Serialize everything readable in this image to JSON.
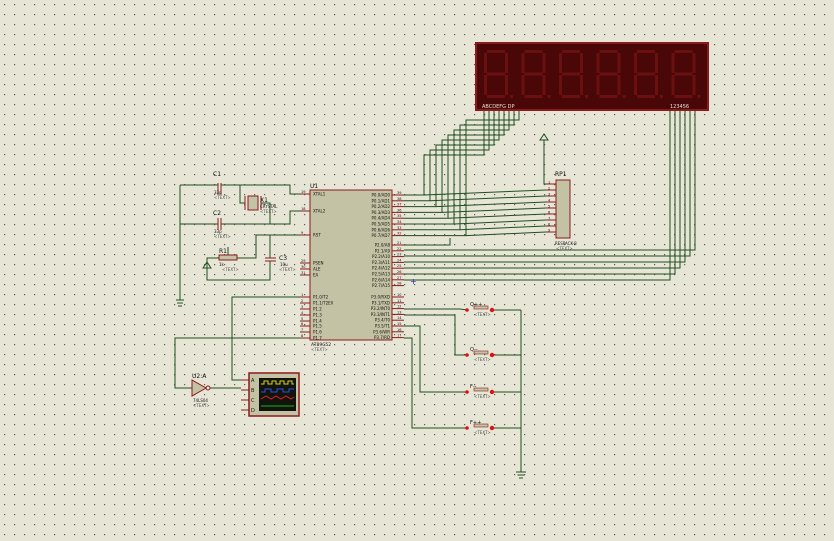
{
  "display": {
    "seg_labels": "ABCDEFG  DP",
    "digit_labels": "123456"
  },
  "u1": {
    "ref": "U1",
    "part": "AT89C52",
    "text_placeholder": "<TEXT>",
    "pins_left": [
      {
        "num": "19",
        "name": "XTAL1"
      },
      {
        "num": "18",
        "name": "XTAL2"
      },
      {
        "num": "9",
        "name": "RST"
      },
      {
        "num": "29",
        "name": "PSEN"
      },
      {
        "num": "30",
        "name": "ALE"
      },
      {
        "num": "31",
        "name": "EA"
      },
      {
        "num": "1",
        "name": "P1.0/T2"
      },
      {
        "num": "2",
        "name": "P1.1/T2EX"
      },
      {
        "num": "3",
        "name": "P1.2"
      },
      {
        "num": "4",
        "name": "P1.3"
      },
      {
        "num": "5",
        "name": "P1.4"
      },
      {
        "num": "6",
        "name": "P1.5"
      },
      {
        "num": "7",
        "name": "P1.6"
      },
      {
        "num": "8",
        "name": "P1.7"
      }
    ],
    "pins_right": [
      {
        "num": "39",
        "name": "P0.0/AD0"
      },
      {
        "num": "38",
        "name": "P0.1/AD1"
      },
      {
        "num": "37",
        "name": "P0.2/AD2"
      },
      {
        "num": "36",
        "name": "P0.3/AD3"
      },
      {
        "num": "35",
        "name": "P0.4/AD4"
      },
      {
        "num": "34",
        "name": "P0.5/AD5"
      },
      {
        "num": "33",
        "name": "P0.6/AD6"
      },
      {
        "num": "32",
        "name": "P0.7/AD7"
      },
      {
        "num": "21",
        "name": "P2.0/A8"
      },
      {
        "num": "22",
        "name": "P2.1/A9"
      },
      {
        "num": "23",
        "name": "P2.2/A10"
      },
      {
        "num": "24",
        "name": "P2.3/A11"
      },
      {
        "num": "25",
        "name": "P2.4/A12"
      },
      {
        "num": "26",
        "name": "P2.5/A13"
      },
      {
        "num": "27",
        "name": "P2.6/A14"
      },
      {
        "num": "28",
        "name": "P2.7/A15"
      },
      {
        "num": "10",
        "name": "P3.0/RXD"
      },
      {
        "num": "11",
        "name": "P3.1/TXD"
      },
      {
        "num": "12",
        "name": "P3.2/INT0"
      },
      {
        "num": "13",
        "name": "P3.3/INT1"
      },
      {
        "num": "14",
        "name": "P3.4/T0"
      },
      {
        "num": "15",
        "name": "P3.5/T1"
      },
      {
        "num": "16",
        "name": "P3.6/WR"
      },
      {
        "num": "17",
        "name": "P3.7/RD"
      }
    ]
  },
  "c1": {
    "ref": "C1",
    "value": "33p",
    "text": "<TEXT>"
  },
  "c2": {
    "ref": "C2",
    "value": "33p",
    "text": "<TEXT>"
  },
  "c3": {
    "ref": "C3",
    "value": "10u",
    "text": "<TEXT>"
  },
  "x1": {
    "ref": "X1",
    "part": "CRYSTAL",
    "text": "<TEXT>"
  },
  "r1": {
    "ref": "R1",
    "value": "1k",
    "text": "<TEXT>"
  },
  "rp1": {
    "ref": "RP1",
    "part": "RESPACK-8",
    "text": "<TEXT>",
    "pins": [
      "1",
      "2",
      "3",
      "4",
      "5",
      "6",
      "7",
      "8",
      "9"
    ]
  },
  "u2": {
    "ref": "U2:A",
    "part": "74LS04",
    "text": "<TEXT>"
  },
  "scope": {
    "pins": [
      "A",
      "B",
      "C",
      "D"
    ]
  },
  "buttons": [
    {
      "label": "Q++",
      "text": "<TEXT>"
    },
    {
      "label": "Q--",
      "text": "<TEXT>"
    },
    {
      "label": "F--",
      "text": "<TEXT>"
    },
    {
      "label": "F++",
      "text": "<TEXT>"
    }
  ],
  "colors": {
    "background": "#e6e5d6",
    "grid_dot": "#5c5c4c",
    "wire": "#1f4d1f",
    "component_border": "#8b1a1a",
    "component_fill": "#c3c2a5",
    "label_text": "#101010",
    "display_body": "#4a0707",
    "segment_off": "#6a1010",
    "button_contact": "#e01010"
  }
}
